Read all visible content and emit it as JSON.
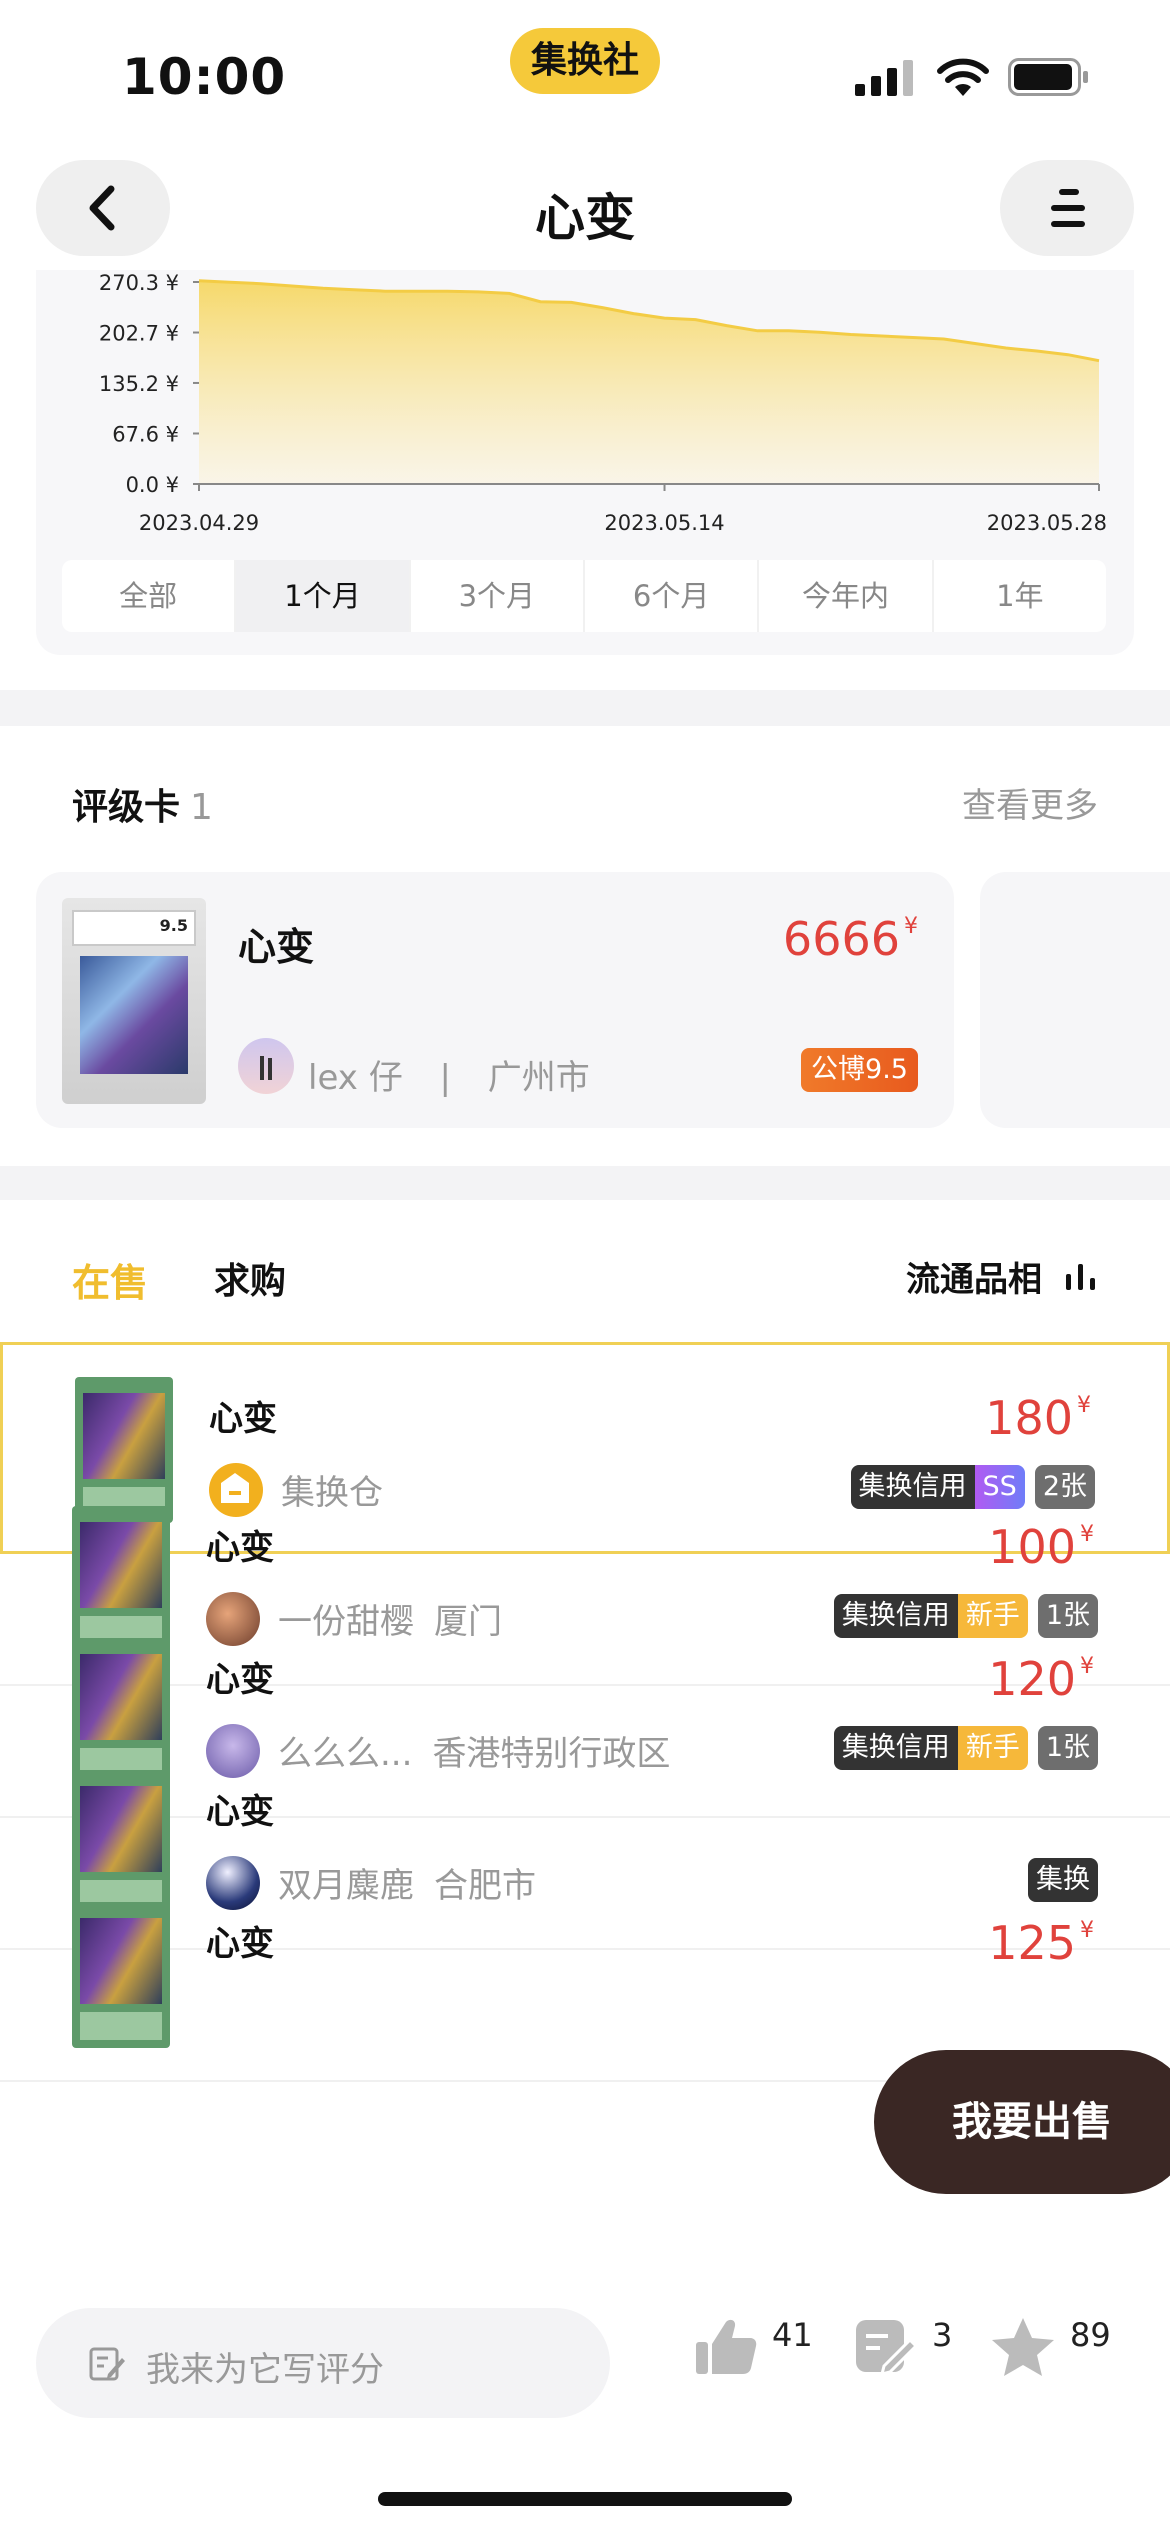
{
  "status_bar": {
    "time": "10:00",
    "app_badge": "集换社"
  },
  "nav": {
    "title": "心变"
  },
  "price_chart": {
    "y_ticks": [
      "270.3 ¥",
      "202.7 ¥",
      "135.2 ¥",
      "67.6 ¥",
      "0.0 ¥"
    ],
    "x_ticks": [
      "2023.04.29",
      "2023.05.14",
      "2023.05.28"
    ],
    "line_color": "#f3cc45",
    "ranges": [
      "全部",
      "1个月",
      "3个月",
      "6个月",
      "今年内",
      "1年"
    ],
    "active_range": "1个月"
  },
  "chart_data": {
    "type": "area",
    "x": [
      "2023.04.29",
      "2023.04.30",
      "2023.05.01",
      "2023.05.02",
      "2023.05.03",
      "2023.05.04",
      "2023.05.05",
      "2023.05.06",
      "2023.05.07",
      "2023.05.08",
      "2023.05.09",
      "2023.05.10",
      "2023.05.11",
      "2023.05.12",
      "2023.05.13",
      "2023.05.14",
      "2023.05.15",
      "2023.05.16",
      "2023.05.17",
      "2023.05.18",
      "2023.05.19",
      "2023.05.20",
      "2023.05.21",
      "2023.05.22",
      "2023.05.23",
      "2023.05.24",
      "2023.05.25",
      "2023.05.26",
      "2023.05.27",
      "2023.05.28"
    ],
    "values": [
      272,
      270,
      268,
      265,
      262,
      260,
      258,
      258,
      258,
      257,
      255,
      244,
      243,
      236,
      228,
      222,
      220,
      212,
      205,
      205,
      203,
      200,
      198,
      196,
      194,
      188,
      182,
      178,
      173,
      165
    ],
    "ylim": [
      0,
      270.3
    ],
    "y_unit": "¥"
  },
  "graded": {
    "title": "评级卡",
    "count": "1",
    "see_more": "查看更多",
    "card": {
      "name": "心变",
      "price": "6666",
      "currency": "¥",
      "seller": "lex 仔",
      "separator": "|",
      "city": "广州市",
      "grade": "公博9.5",
      "slab_grade": "9.5"
    }
  },
  "listings": {
    "tab_sale": "在售",
    "tab_buy": "求购",
    "sort_label": "流通品相",
    "currency": "¥",
    "rows": [
      {
        "name": "心变",
        "price": "180",
        "seller": "集换仓",
        "location": "",
        "credit": "集换信用",
        "level": "SS",
        "count": "2张"
      },
      {
        "name": "心变",
        "price": "100",
        "seller": "一份甜樱",
        "location": "厦门",
        "credit": "集换信用",
        "level": "新手",
        "count": "1张"
      },
      {
        "name": "心变",
        "price": "120",
        "seller": "么么么...",
        "location": "香港特别行政区",
        "credit": "集换信用",
        "level": "新手",
        "count": "1张"
      },
      {
        "name": "心变",
        "price": "",
        "seller": "双月麋鹿",
        "location": "合肥市",
        "credit": "集换",
        "level": "",
        "count": ""
      },
      {
        "name": "心变",
        "price": "125",
        "seller": "",
        "location": "",
        "credit": "",
        "level": "",
        "count": ""
      }
    ]
  },
  "sell_button": "我要出售",
  "bottom_bar": {
    "review_placeholder": "我来为它写评分",
    "likes": "41",
    "comments": "3",
    "favorites": "89"
  }
}
